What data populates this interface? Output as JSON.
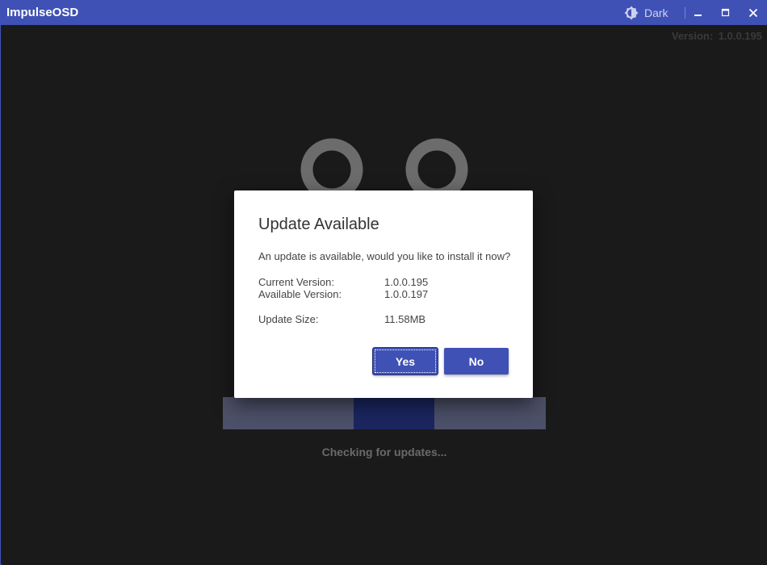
{
  "window": {
    "title": "ImpulseOSD",
    "theme_label": "Dark",
    "theme_icon": "theme-contrast-icon",
    "controls": [
      "minimize-icon",
      "maximize-icon",
      "close-icon"
    ]
  },
  "version": {
    "text": "Version: 1.0.0.195"
  },
  "splash": {
    "status": "Checking for updates...",
    "progress_fraction": 0.25
  },
  "dialog": {
    "title": "Update Available",
    "message": "An update is available, would you like to install it now?",
    "current_version_label": "Current Version:",
    "current_version_value": "1.0.0.195",
    "available_version_label": "Available Version:",
    "available_version_value": "1.0.0.197",
    "size_label": "Update Size:",
    "size_value": "11.58MB",
    "yes_label": "Yes",
    "no_label": "No"
  },
  "colors": {
    "accent": "#3f51b5",
    "background": "#1a1a1a",
    "progress_track": "#4c5068",
    "progress_fill": "#1b2660"
  }
}
